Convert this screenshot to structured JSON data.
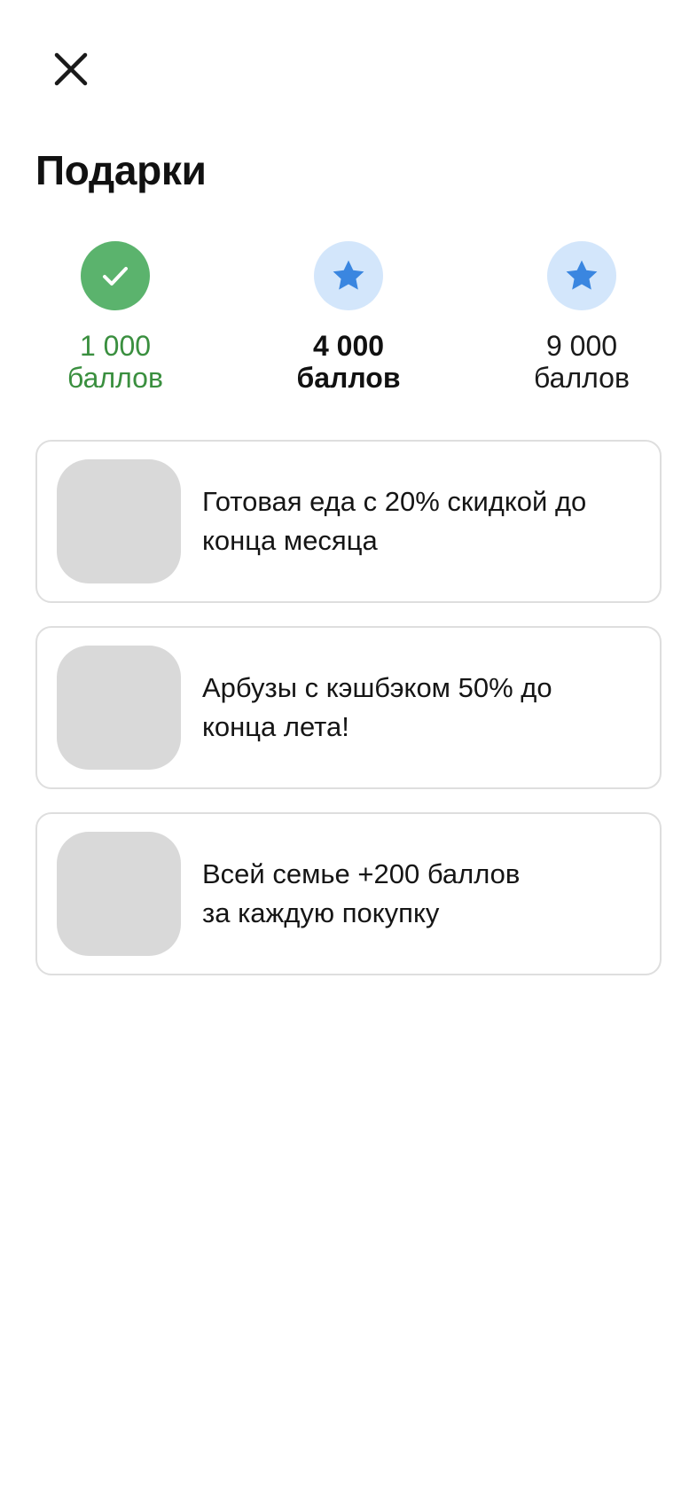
{
  "header": {
    "close_icon": "close-icon",
    "title": "Подарки"
  },
  "levels": [
    {
      "points": "1 000",
      "unit": "баллов",
      "state": "reached",
      "icon": "check-icon"
    },
    {
      "points": "4 000",
      "unit": "баллов",
      "state": "current",
      "icon": "star-icon"
    },
    {
      "points": "9 000",
      "unit": "баллов",
      "state": "next",
      "icon": "star-icon"
    }
  ],
  "gifts": [
    {
      "text": "Готовая еда  с 20% скидкой до\nконца месяца"
    },
    {
      "text": "Арбузы с кэшбэком 50% до\nконца лета!"
    },
    {
      "text": "Всей семье +200 баллов\nза каждую покупку"
    }
  ],
  "colors": {
    "reached": "#5bb36d",
    "reached_text": "#3a8f3f",
    "star_bg": "#d3e6fb",
    "star": "#3a86e0",
    "card_border": "#dedede",
    "thumb": "#d9d9d9"
  }
}
